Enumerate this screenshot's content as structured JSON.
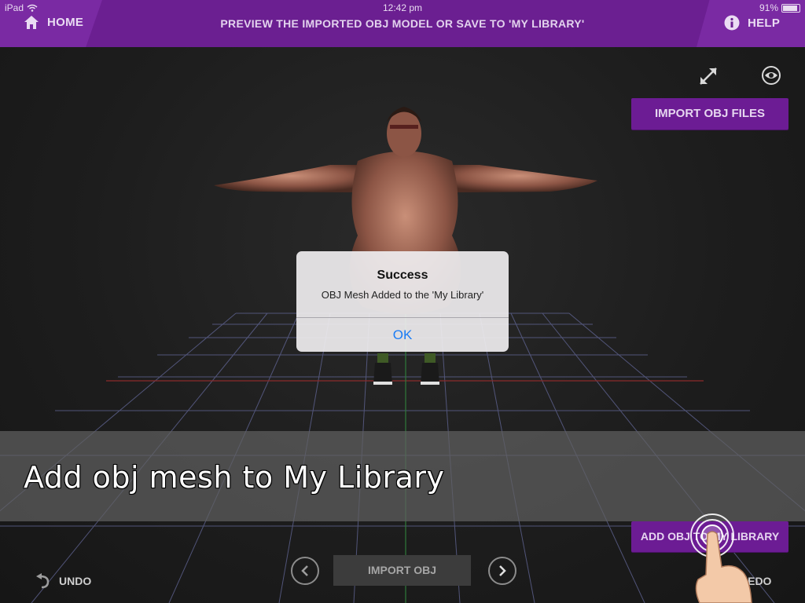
{
  "status": {
    "device": "iPad",
    "time": "12:42 pm",
    "battery": "91%"
  },
  "topbar": {
    "home_label": "HOME",
    "title": "PREVIEW THE IMPORTED OBJ MODEL OR SAVE TO 'MY LIBRARY'",
    "help_label": "HELP"
  },
  "viewport": {
    "import_files_label": "IMPORT OBJ FILES",
    "add_library_label": "ADD OBJ TO MY LIBRARY"
  },
  "caption": {
    "text": "Add obj mesh to My Library"
  },
  "alert": {
    "title": "Success",
    "message": "OBJ Mesh Added to the 'My Library'",
    "ok_label": "OK"
  },
  "bottombar": {
    "undo_label": "UNDO",
    "import_obj_label": "IMPORT OBJ",
    "redo_label": "REDO"
  },
  "icons": [
    "home-icon",
    "info-icon",
    "wifi-icon",
    "battery-icon",
    "fullscreen-icon",
    "eye-icon",
    "undo-icon",
    "chevron-left-icon",
    "chevron-right-icon",
    "tap-hand-icon"
  ],
  "colors": {
    "brand_purple": "#6b1f91",
    "alert_link_blue": "#1a7cf5"
  }
}
